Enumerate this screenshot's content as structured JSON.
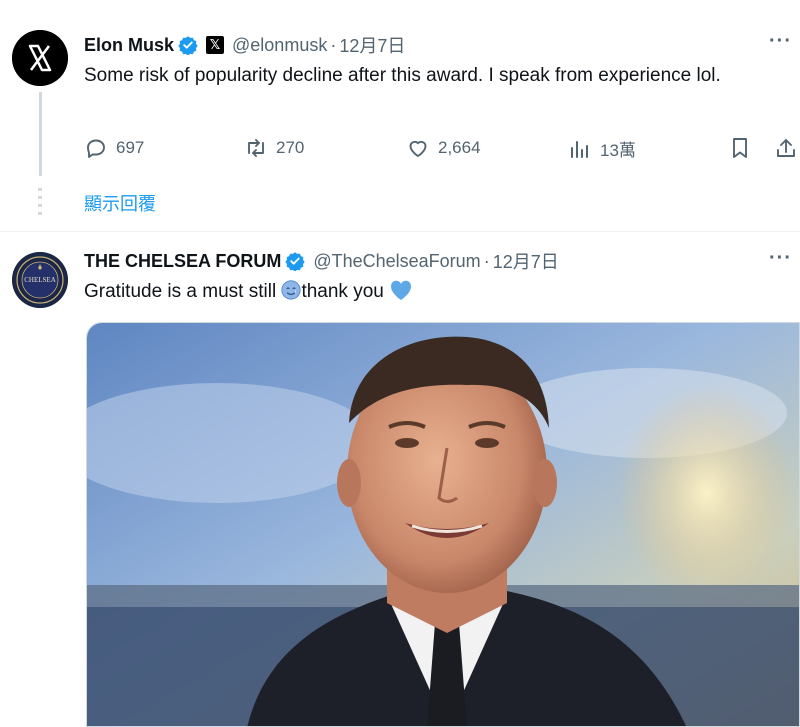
{
  "tweets": [
    {
      "author_name": "Elon Musk",
      "affiliate_badge": "𝕏",
      "handle": "@elonmusk",
      "separator": "·",
      "timestamp": "12月7日",
      "text": "Some risk of popularity decline after this award. I speak from experience lol.",
      "replies": "697",
      "reposts": "270",
      "likes": "2,664",
      "views": "13萬",
      "show_replies": "顯示回覆",
      "avatar_icon": "x-logo"
    },
    {
      "author_name": "THE CHELSEA FORUM",
      "handle": "@TheChelseaForum",
      "separator": "·",
      "timestamp": "12月7日",
      "text_part1": "Gratitude is a must still ",
      "text_part2": "thank you ",
      "avatar_label": "CHELSEA",
      "emoji_icons": [
        "smiling-face-with-tear-emoji",
        "blue-heart-emoji"
      ],
      "media_icon": "photo-man-in-suit"
    }
  ],
  "colors": {
    "verified_blue": "#1d9bf0",
    "link_blue": "#1d9bf0",
    "secondary_text": "#536471",
    "primary_text": "#0f1419"
  }
}
